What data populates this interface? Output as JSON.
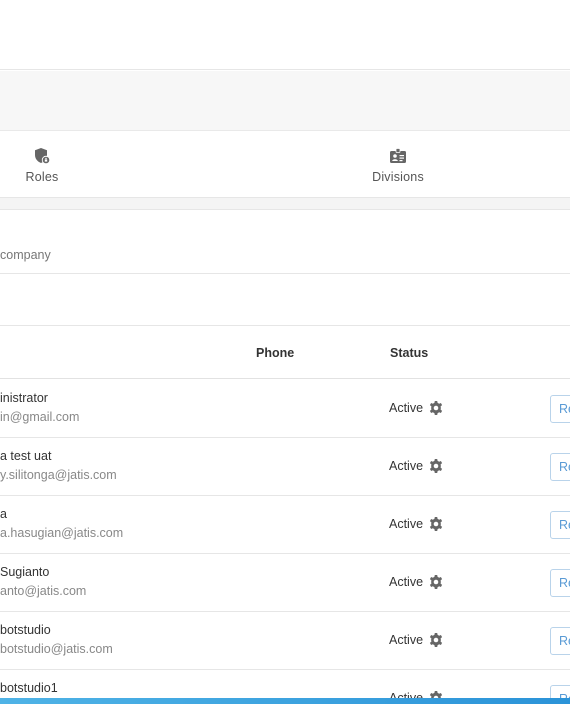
{
  "tabs": [
    {
      "label": "Roles",
      "icon": "shield-lock-icon"
    },
    {
      "label": "Divisions",
      "icon": "id-badge-icon"
    }
  ],
  "company": {
    "text": "company"
  },
  "table": {
    "headers": {
      "phone": "Phone",
      "status": "Status"
    },
    "rows": [
      {
        "name": "inistrator",
        "email": "in@gmail.com",
        "status": "Active",
        "action": "Re"
      },
      {
        "name": "a test uat",
        "email": "y.silitonga@jatis.com",
        "status": "Active",
        "action": "Re"
      },
      {
        "name": "a",
        "email": "a.hasugian@jatis.com",
        "status": "Active",
        "action": "Re"
      },
      {
        "name": "Sugianto",
        "email": "anto@jatis.com",
        "status": "Active",
        "action": "Re"
      },
      {
        "name": "botstudio",
        "email": "botstudio@jatis.com",
        "status": "Active",
        "action": "Re"
      },
      {
        "name": "botstudio1",
        "email": "",
        "status": "Active",
        "action": "Re"
      }
    ]
  },
  "colors": {
    "accent": "#5a9bd5",
    "bottom_bar": "#2b93d8",
    "icon": "#666666"
  }
}
